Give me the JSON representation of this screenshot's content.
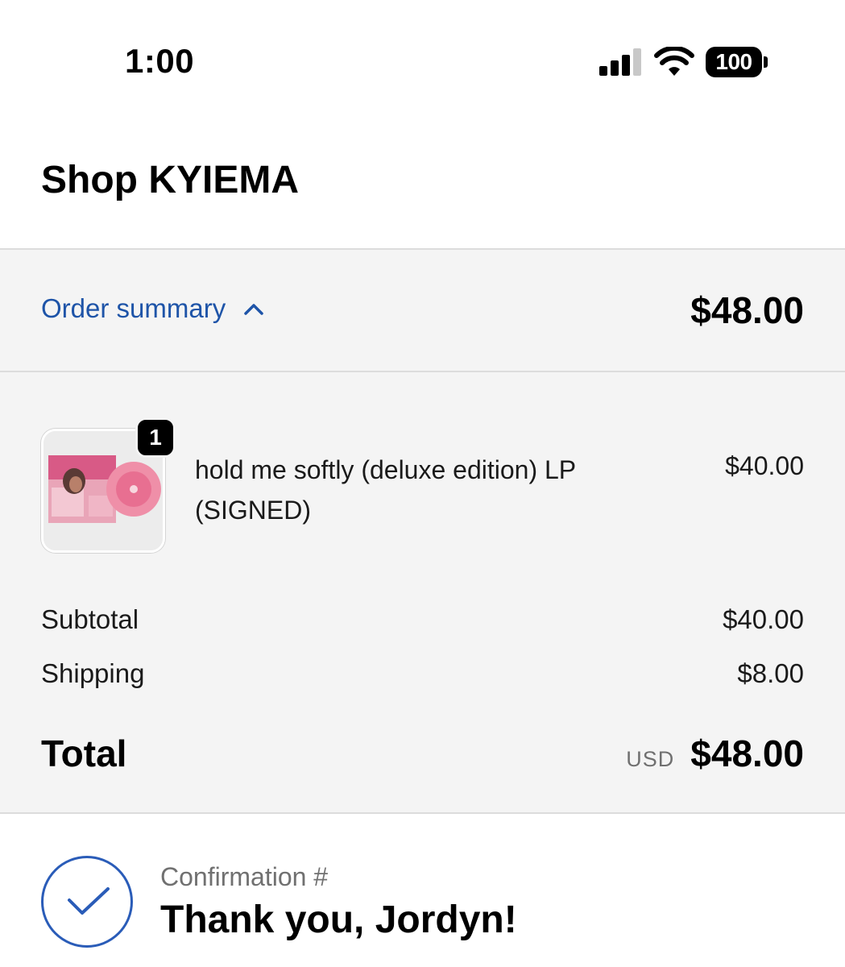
{
  "status_bar": {
    "time": "1:00",
    "battery": "100"
  },
  "shop": {
    "title": "Shop KYIEMA"
  },
  "summary": {
    "toggle_label": "Order summary",
    "total": "$48.00"
  },
  "item": {
    "quantity": "1",
    "name": "hold me softly (deluxe edition) LP (SIGNED)",
    "price": "$40.00",
    "image_icon": "album-cover-image"
  },
  "totals": {
    "subtotal_label": "Subtotal",
    "subtotal_value": "$40.00",
    "shipping_label": "Shipping",
    "shipping_value": "$8.00",
    "total_label": "Total",
    "currency": "USD",
    "total_value": "$48.00"
  },
  "confirmation": {
    "label": "Confirmation #",
    "message": "Thank you, Jordyn!"
  },
  "colors": {
    "link": "#1e54a8",
    "panel": "#f4f4f4",
    "check": "#2a5cb8"
  }
}
